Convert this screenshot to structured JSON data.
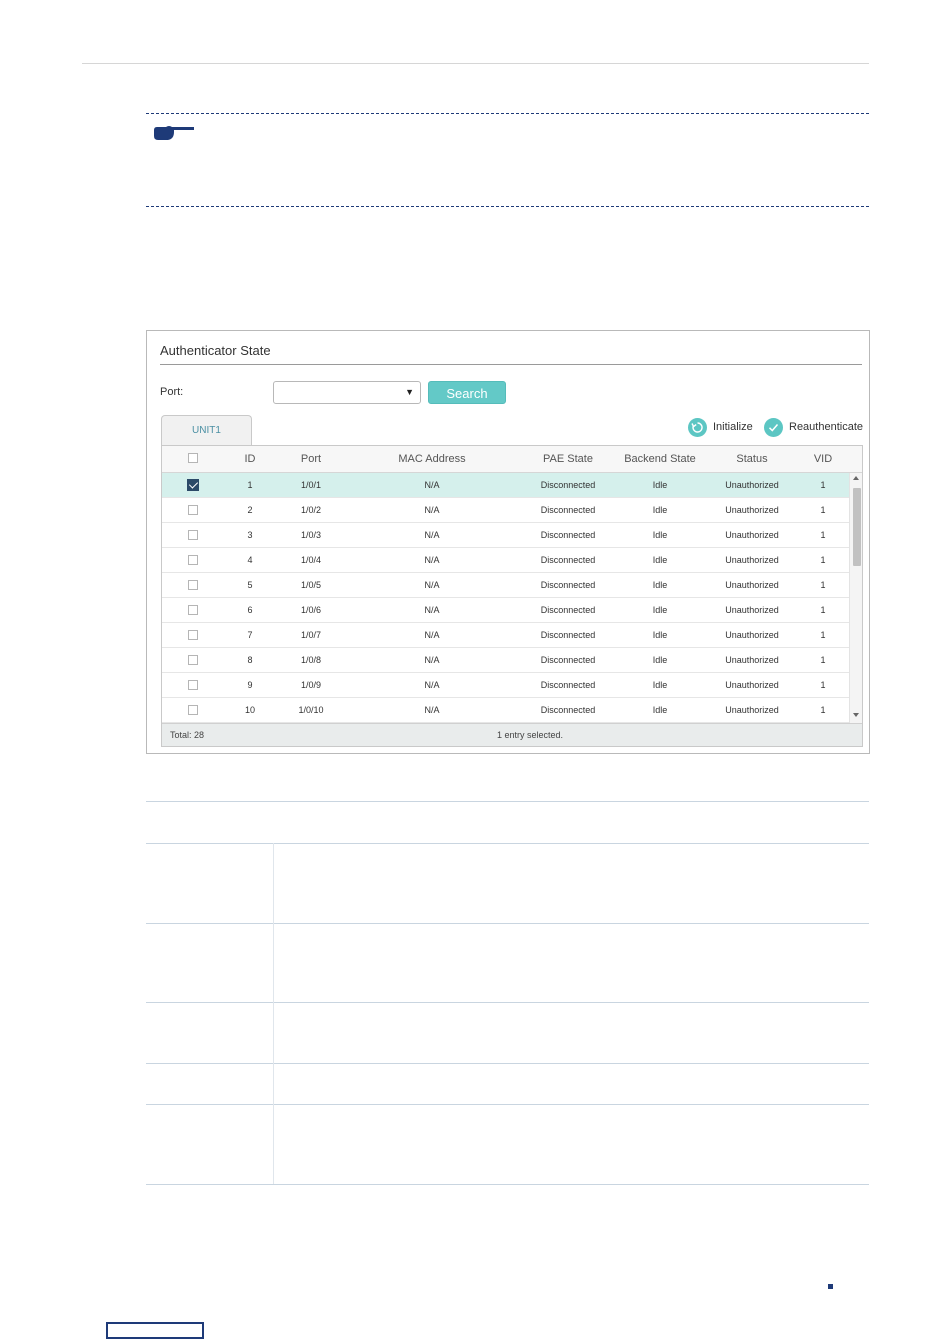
{
  "panel": {
    "title": "Authenticator State",
    "port_label": "Port:",
    "port_value": "",
    "search_label": "Search",
    "tab_label": "UNIT1",
    "actions": {
      "initialize": "Initialize",
      "reauthenticate": "Reauthenticate"
    },
    "columns": [
      "ID",
      "Port",
      "MAC Address",
      "PAE State",
      "Backend State",
      "Status",
      "VID"
    ],
    "rows": [
      {
        "checked": true,
        "id": "1",
        "port": "1/0/1",
        "mac": "N/A",
        "pae": "Disconnected",
        "backend": "Idle",
        "status": "Unauthorized",
        "vid": "1"
      },
      {
        "checked": false,
        "id": "2",
        "port": "1/0/2",
        "mac": "N/A",
        "pae": "Disconnected",
        "backend": "Idle",
        "status": "Unauthorized",
        "vid": "1"
      },
      {
        "checked": false,
        "id": "3",
        "port": "1/0/3",
        "mac": "N/A",
        "pae": "Disconnected",
        "backend": "Idle",
        "status": "Unauthorized",
        "vid": "1"
      },
      {
        "checked": false,
        "id": "4",
        "port": "1/0/4",
        "mac": "N/A",
        "pae": "Disconnected",
        "backend": "Idle",
        "status": "Unauthorized",
        "vid": "1"
      },
      {
        "checked": false,
        "id": "5",
        "port": "1/0/5",
        "mac": "N/A",
        "pae": "Disconnected",
        "backend": "Idle",
        "status": "Unauthorized",
        "vid": "1"
      },
      {
        "checked": false,
        "id": "6",
        "port": "1/0/6",
        "mac": "N/A",
        "pae": "Disconnected",
        "backend": "Idle",
        "status": "Unauthorized",
        "vid": "1"
      },
      {
        "checked": false,
        "id": "7",
        "port": "1/0/7",
        "mac": "N/A",
        "pae": "Disconnected",
        "backend": "Idle",
        "status": "Unauthorized",
        "vid": "1"
      },
      {
        "checked": false,
        "id": "8",
        "port": "1/0/8",
        "mac": "N/A",
        "pae": "Disconnected",
        "backend": "Idle",
        "status": "Unauthorized",
        "vid": "1"
      },
      {
        "checked": false,
        "id": "9",
        "port": "1/0/9",
        "mac": "N/A",
        "pae": "Disconnected",
        "backend": "Idle",
        "status": "Unauthorized",
        "vid": "1"
      },
      {
        "checked": false,
        "id": "10",
        "port": "1/0/10",
        "mac": "N/A",
        "pae": "Disconnected",
        "backend": "Idle",
        "status": "Unauthorized",
        "vid": "1"
      }
    ],
    "footer": {
      "total": "Total: 28",
      "selected": "1 entry selected."
    }
  },
  "icons": {
    "note": "pointing-hand-icon",
    "initialize": "refresh-icon",
    "reauthenticate": "check-icon"
  },
  "colors": {
    "accent": "#63c9c7",
    "selected_row": "#d5f0ec",
    "rule_dark": "#1e3a78"
  }
}
